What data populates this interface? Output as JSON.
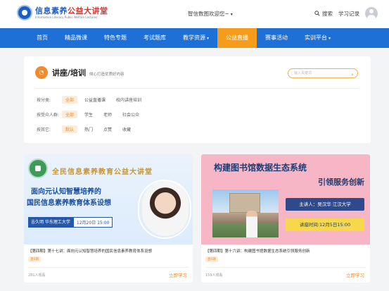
{
  "header": {
    "logo_title_part1": "信息素养",
    "logo_title_part2": "公益大讲堂",
    "logo_subtitle": "Information Literacy Public Welfare Lectures",
    "center_link": "智信数图欢迎您~",
    "search_label": "搜索",
    "history_label": "学习记录"
  },
  "nav": {
    "items": [
      {
        "label": "首页"
      },
      {
        "label": "精品微课"
      },
      {
        "label": "特色专题"
      },
      {
        "label": "考试题库"
      },
      {
        "label": "教学资源",
        "caret": "▾"
      },
      {
        "label": "公益直播"
      },
      {
        "label": "赛事活动"
      },
      {
        "label": "实训平台",
        "caret": "▾"
      }
    ],
    "active_index": 5
  },
  "filter_card": {
    "icon_glyph": "◔",
    "title": "讲座/培训",
    "subtitle": "倾心打造优质好内容",
    "search_placeholder": "输入关键词",
    "rows": [
      {
        "label": "按分类:",
        "options": [
          "全部",
          "公益直播课",
          "校内讲座培训"
        ],
        "selected": 0
      },
      {
        "label": "按受众人群:",
        "options": [
          "全部",
          "学生",
          "老师",
          "社会公众"
        ],
        "selected": 0
      },
      {
        "label": "按其它:",
        "options": [
          "默认",
          "热门",
          "点赞",
          "收藏"
        ],
        "selected": 0
      }
    ]
  },
  "courses": [
    {
      "banner": {
        "heading": "全民信息素养教育公益大讲堂",
        "line1": "面向元认知智慧培养的",
        "line2": "国民信息素养教育体系设想",
        "speaker": "吉久明 华东理工大学",
        "time": "12月20日 15:00"
      },
      "title": "【第四期】第十七讲：面向元认知智慧培养的国民信息素养教育体系设想",
      "tag": "直S期",
      "views": "281人观看",
      "action": "立即学习"
    },
    {
      "banner": {
        "line1": "构建图书馆数据生态系统",
        "line2": "引领服务创新",
        "speaker": "主讲人：吴汉华 江汉大学",
        "time": "讲座时间:12月5日15:00"
      },
      "title": "【第四期】第十六讲：构建图书馆数据生态系统引领服务创新",
      "tag": "直S期",
      "views": "159人观看",
      "action": "立即学习"
    }
  ]
}
